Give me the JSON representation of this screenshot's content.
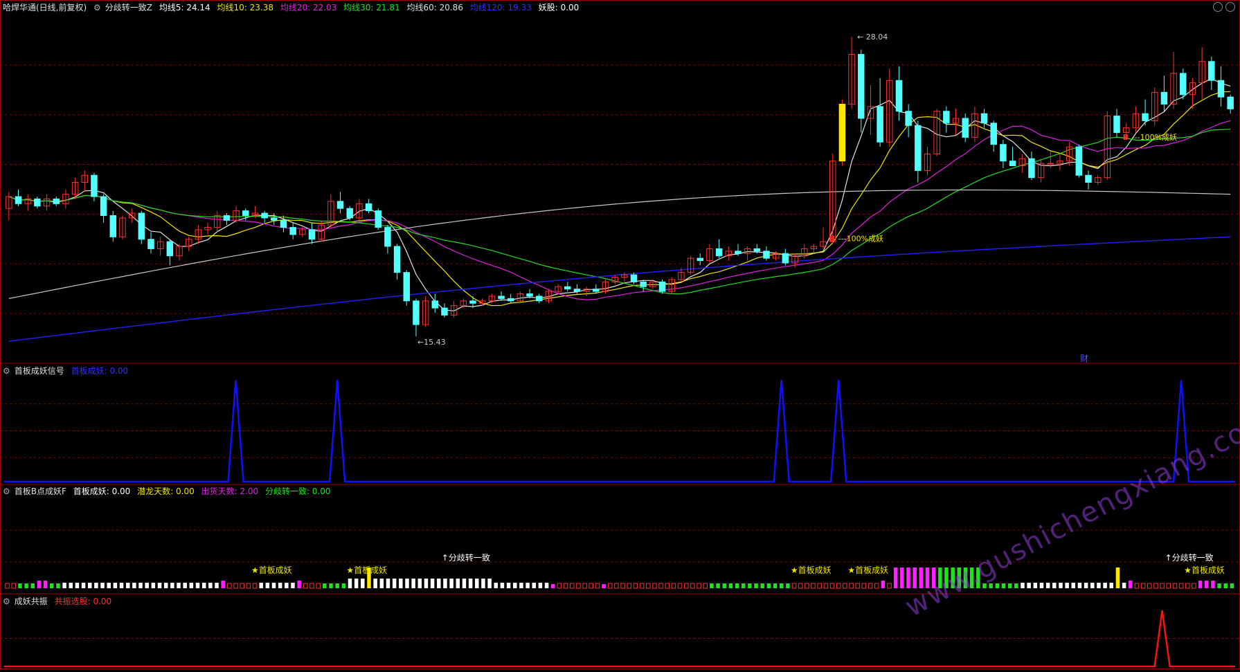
{
  "colors": {
    "ma5": "#e6e6e6",
    "ma10": "#f2e600",
    "ma20": "#e020e0",
    "ma30": "#20e020",
    "ma60": "#c8c8c8",
    "ma120": "#2020ff",
    "up": "#ff3030",
    "down": "#54ffff",
    "grid": "#8a0000"
  },
  "header": {
    "title": "哈焊华通(日线,前复权)",
    "indicator": "分歧转一致Z",
    "ma5": "均线5: 24.14",
    "ma10": "均线10: 23.38",
    "ma20": "均线20: 22.03",
    "ma30": "均线30: 21.81",
    "ma60": "均线60: 20.86",
    "ma120": "均线120: 19.33",
    "yaogu": "妖股: 0.00"
  },
  "panel2": {
    "title": "首板成妖信号",
    "value": "首板成妖: 0.00"
  },
  "panel3": {
    "title": "首板B点成妖F",
    "v1": "首板成妖: 0.00",
    "v2": "潜龙天数: 0.00",
    "v3": "出货天数: 2.00",
    "v4": "分歧转一致: 0.00"
  },
  "panel4": {
    "title": "成妖共振",
    "value": "共振选股: 0.00"
  },
  "watermark": "www.gushichengxiang.com",
  "chart_data": [
    {
      "type": "candlestick",
      "annotations": {
        "high": "28.04",
        "low": "15.43",
        "signal": "100%成妖",
        "signal_marker": "B",
        "cai": "财"
      },
      "ylim": [
        14.5,
        28.6
      ],
      "candles": [
        [
          20.8,
          21.5,
          20.3,
          21.3
        ],
        [
          21.3,
          21.6,
          20.9,
          21.0
        ],
        [
          21.0,
          21.4,
          20.7,
          21.2
        ],
        [
          21.2,
          21.3,
          20.8,
          20.9
        ],
        [
          20.9,
          21.4,
          20.7,
          21.2
        ],
        [
          21.2,
          21.3,
          20.9,
          21.0
        ],
        [
          21.0,
          21.6,
          20.8,
          21.4
        ],
        [
          21.4,
          22.1,
          21.2,
          21.9
        ],
        [
          21.9,
          22.4,
          21.5,
          22.2
        ],
        [
          22.2,
          22.3,
          21.1,
          21.3
        ],
        [
          21.3,
          21.4,
          20.2,
          20.5
        ],
        [
          20.5,
          20.7,
          19.4,
          19.6
        ],
        [
          19.6,
          20.5,
          19.5,
          20.4
        ],
        [
          20.4,
          20.8,
          20.2,
          20.6
        ],
        [
          20.6,
          20.7,
          19.3,
          19.5
        ],
        [
          19.5,
          19.8,
          18.9,
          19.1
        ],
        [
          19.1,
          19.6,
          18.8,
          19.4
        ],
        [
          19.4,
          19.5,
          18.4,
          18.8
        ],
        [
          18.8,
          19.3,
          18.6,
          19.2
        ],
        [
          19.2,
          19.6,
          19.0,
          19.5
        ],
        [
          19.5,
          20.1,
          19.3,
          19.9
        ],
        [
          19.9,
          20.2,
          19.7,
          20.0
        ],
        [
          20.0,
          20.7,
          19.8,
          20.5
        ],
        [
          20.5,
          20.6,
          20.1,
          20.3
        ],
        [
          20.3,
          20.9,
          20.2,
          20.7
        ],
        [
          20.7,
          20.8,
          20.3,
          20.5
        ],
        [
          20.5,
          20.9,
          20.4,
          20.6
        ],
        [
          20.6,
          20.7,
          20.2,
          20.4
        ],
        [
          20.4,
          20.6,
          20.1,
          20.3
        ],
        [
          20.3,
          20.5,
          19.8,
          20.0
        ],
        [
          20.0,
          20.2,
          19.5,
          19.7
        ],
        [
          19.7,
          20.0,
          19.6,
          19.9
        ],
        [
          19.9,
          20.2,
          19.3,
          19.5
        ],
        [
          19.5,
          20.3,
          19.4,
          20.1
        ],
        [
          20.1,
          21.4,
          20.0,
          21.1
        ],
        [
          21.1,
          21.5,
          20.6,
          20.8
        ],
        [
          20.8,
          20.9,
          20.3,
          20.4
        ],
        [
          20.4,
          21.2,
          20.3,
          21.0
        ],
        [
          21.0,
          21.2,
          20.6,
          20.7
        ],
        [
          20.7,
          20.8,
          19.9,
          20.0
        ],
        [
          20.0,
          20.1,
          18.9,
          19.2
        ],
        [
          19.2,
          19.3,
          17.8,
          18.1
        ],
        [
          18.1,
          18.2,
          16.7,
          16.9
        ],
        [
          16.9,
          17.0,
          15.4,
          15.9
        ],
        [
          15.9,
          17.1,
          15.8,
          16.9
        ],
        [
          16.9,
          17.2,
          16.4,
          16.6
        ],
        [
          16.6,
          16.8,
          16.2,
          16.3
        ],
        [
          16.3,
          16.9,
          16.2,
          16.7
        ],
        [
          16.7,
          17.0,
          16.6,
          16.9
        ],
        [
          16.9,
          17.1,
          16.6,
          16.8
        ],
        [
          16.8,
          17.0,
          16.7,
          16.9
        ],
        [
          16.9,
          17.2,
          16.8,
          17.1
        ],
        [
          17.1,
          17.3,
          16.9,
          17.0
        ],
        [
          17.0,
          17.2,
          16.8,
          16.9
        ],
        [
          16.9,
          17.3,
          16.8,
          17.2
        ],
        [
          17.2,
          17.4,
          17.0,
          17.1
        ],
        [
          17.1,
          17.2,
          16.8,
          16.9
        ],
        [
          16.9,
          17.4,
          16.8,
          17.3
        ],
        [
          17.3,
          17.6,
          17.2,
          17.5
        ],
        [
          17.5,
          17.7,
          17.3,
          17.4
        ],
        [
          17.4,
          17.6,
          17.2,
          17.3
        ],
        [
          17.3,
          17.5,
          17.1,
          17.4
        ],
        [
          17.4,
          17.6,
          17.2,
          17.3
        ],
        [
          17.3,
          17.8,
          17.2,
          17.7
        ],
        [
          17.7,
          18.0,
          17.6,
          17.9
        ],
        [
          17.9,
          18.1,
          17.7,
          18.0
        ],
        [
          18.0,
          18.1,
          17.6,
          17.7
        ],
        [
          17.7,
          17.8,
          17.3,
          17.5
        ],
        [
          17.5,
          17.8,
          17.4,
          17.7
        ],
        [
          17.7,
          17.8,
          17.2,
          17.3
        ],
        [
          17.3,
          17.9,
          17.2,
          17.8
        ],
        [
          17.8,
          18.3,
          17.7,
          18.1
        ],
        [
          18.1,
          18.8,
          18.0,
          18.7
        ],
        [
          18.7,
          18.9,
          18.4,
          18.6
        ],
        [
          18.6,
          19.3,
          18.5,
          19.1
        ],
        [
          19.1,
          19.5,
          18.7,
          18.8
        ],
        [
          18.8,
          19.2,
          18.6,
          19.0
        ],
        [
          19.0,
          19.3,
          18.8,
          18.9
        ],
        [
          18.9,
          19.2,
          18.6,
          19.1
        ],
        [
          19.1,
          19.3,
          18.9,
          19.0
        ],
        [
          19.0,
          19.2,
          18.6,
          18.7
        ],
        [
          18.7,
          19.0,
          18.6,
          18.9
        ],
        [
          18.9,
          19.1,
          18.4,
          18.5
        ],
        [
          18.5,
          18.9,
          18.3,
          18.8
        ],
        [
          18.8,
          19.3,
          18.7,
          19.1
        ],
        [
          19.1,
          19.3,
          18.9,
          19.2
        ],
        [
          19.2,
          20.0,
          19.1,
          19.4
        ],
        [
          19.4,
          23.1,
          19.3,
          22.8
        ],
        [
          22.8,
          25.4,
          22.6,
          25.2
        ],
        [
          25.2,
          28.04,
          25.0,
          27.3
        ],
        [
          27.3,
          27.5,
          24.0,
          24.6
        ],
        [
          24.6,
          26.0,
          23.9,
          25.1
        ],
        [
          25.1,
          26.3,
          23.4,
          23.6
        ],
        [
          23.6,
          26.7,
          23.4,
          26.2
        ],
        [
          26.2,
          26.8,
          24.5,
          24.9
        ],
        [
          24.9,
          25.2,
          23.8,
          24.3
        ],
        [
          24.3,
          24.5,
          21.9,
          22.4
        ],
        [
          22.4,
          23.4,
          22.2,
          23.1
        ],
        [
          23.1,
          25.0,
          23.0,
          24.9
        ],
        [
          24.9,
          25.1,
          24.0,
          24.4
        ],
        [
          24.4,
          25.0,
          23.9,
          24.6
        ],
        [
          24.6,
          24.8,
          23.6,
          23.8
        ],
        [
          23.8,
          25.1,
          23.6,
          24.8
        ],
        [
          24.8,
          25.0,
          24.2,
          24.4
        ],
        [
          24.4,
          24.5,
          23.2,
          23.5
        ],
        [
          23.5,
          23.7,
          22.5,
          22.8
        ],
        [
          22.8,
          23.4,
          22.6,
          22.6
        ],
        [
          22.6,
          23.1,
          22.3,
          22.9
        ],
        [
          22.9,
          23.2,
          22.0,
          22.1
        ],
        [
          22.1,
          22.9,
          21.9,
          22.7
        ],
        [
          22.7,
          23.2,
          22.5,
          22.7
        ],
        [
          22.7,
          23.1,
          22.4,
          22.8
        ],
        [
          22.8,
          23.6,
          22.6,
          23.4
        ],
        [
          23.4,
          23.5,
          22.1,
          22.2
        ],
        [
          22.2,
          22.4,
          21.6,
          21.9
        ],
        [
          21.9,
          22.2,
          21.8,
          22.1
        ],
        [
          22.1,
          24.9,
          22.0,
          24.7
        ],
        [
          24.7,
          25.0,
          23.8,
          24.0
        ],
        [
          24.0,
          24.4,
          23.7,
          24.2
        ],
        [
          24.2,
          25.1,
          24.0,
          24.8
        ],
        [
          24.8,
          25.4,
          24.3,
          24.5
        ],
        [
          24.5,
          25.9,
          24.3,
          25.7
        ],
        [
          25.7,
          26.4,
          24.9,
          25.2
        ],
        [
          25.2,
          27.4,
          25.0,
          26.5
        ],
        [
          26.5,
          26.7,
          25.4,
          25.6
        ],
        [
          25.6,
          26.3,
          25.0,
          26.1
        ],
        [
          26.1,
          27.6,
          25.4,
          27.0
        ],
        [
          27.0,
          27.2,
          25.8,
          26.2
        ],
        [
          26.2,
          26.8,
          25.1,
          25.5
        ],
        [
          25.5,
          25.6,
          24.8,
          25.0
        ]
      ],
      "signal_index": 88,
      "signal2_index": 118
    },
    {
      "type": "line",
      "series": [
        {
          "name": "首板成妖",
          "x_peaks": [
            36,
            52,
            122,
            131,
            185
          ],
          "values_peak": 1
        }
      ],
      "ylim": [
        0,
        1.1
      ]
    },
    {
      "type": "bar",
      "bars": [
        "r",
        "r",
        "g",
        "g",
        "g",
        "m",
        "m",
        "g",
        "g",
        "w",
        "w",
        "w",
        "w",
        "w",
        "w",
        "w",
        "w",
        "w",
        "w",
        "w",
        "w",
        "w",
        "w",
        "w",
        "w",
        "w",
        "w",
        "w",
        "w",
        "w",
        "w",
        "w",
        "w",
        "w",
        "m",
        "r",
        "r",
        "r",
        "r",
        "r",
        "w",
        "w",
        "w",
        "w",
        "w",
        "w",
        "m",
        "r",
        "r",
        "r",
        "g",
        "g",
        "g",
        "g",
        "w",
        "w",
        "w",
        "y",
        "w",
        "w",
        "w",
        "w",
        "w",
        "w",
        "w",
        "w",
        "w",
        "w",
        "w",
        "w",
        "w",
        "w",
        "w",
        "w",
        "w",
        "w",
        "w",
        "w",
        "w",
        "w",
        "w",
        "w",
        "w",
        "w",
        "w",
        "w",
        "m",
        "r",
        "r",
        "r",
        "r",
        "r",
        "r",
        "r",
        "m",
        "r",
        "r",
        "r",
        "r",
        "r",
        "r",
        "r",
        "r",
        "r",
        "r",
        "r",
        "r",
        "r",
        "r",
        "r",
        "r",
        "g",
        "g",
        "g",
        "g",
        "g",
        "g",
        "g",
        "g",
        "g",
        "g",
        "g",
        "g",
        "g",
        "r",
        "r",
        "r",
        "r",
        "r",
        "r",
        "r",
        "r",
        "r",
        "r",
        "r",
        "r",
        "r",
        "r",
        "m",
        "r",
        "m",
        "m",
        "m",
        "m",
        "m",
        "m",
        "m",
        "g",
        "g",
        "g",
        "g",
        "g",
        "g",
        "g",
        "g",
        "g",
        "g",
        "g",
        "g",
        "g",
        "w",
        "w",
        "w",
        "w",
        "w",
        "w",
        "w",
        "w",
        "w",
        "w",
        "w",
        "w",
        "w",
        "w",
        "w",
        "y",
        "w",
        "m",
        "r",
        "r",
        "r",
        "r",
        "r",
        "r",
        "r",
        "r",
        "r",
        "r",
        "m",
        "m",
        "m",
        "g",
        "g",
        "g"
      ],
      "labels": [
        {
          "i": 38,
          "text": "首板成妖"
        },
        {
          "i": 53,
          "text": "首板成妖"
        },
        {
          "i": 68,
          "text": "分歧转一致"
        },
        {
          "i": 123,
          "text": "首板成妖"
        },
        {
          "i": 132,
          "text": "首板成妖"
        },
        {
          "i": 182,
          "text": "分歧转一致"
        },
        {
          "i": 185,
          "text": "首板成妖"
        }
      ]
    },
    {
      "type": "line",
      "series": [
        {
          "name": "共振选股",
          "x_peaks": [
            182
          ],
          "values_peak": 1
        }
      ],
      "ylim": [
        0,
        1.1
      ]
    }
  ]
}
